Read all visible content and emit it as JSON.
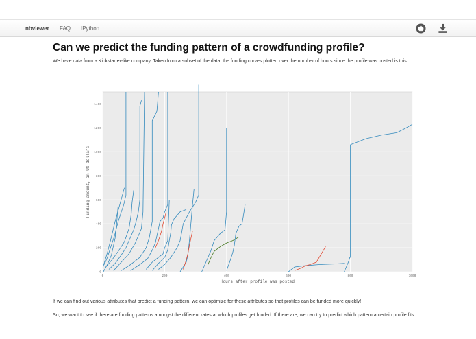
{
  "nav": {
    "brand": "nbviewer",
    "links": [
      "FAQ",
      "IPython"
    ],
    "icons": [
      "github-icon",
      "download-icon"
    ]
  },
  "page": {
    "title": "Can we predict the funding pattern of a crowdfunding profile?",
    "intro": "We have data from a Kickstarter-like company. Taken from a subset of the data, the funding curves plotted over the number of hours since the profile was posted is this:",
    "para1": "If we can find out various attributes that predict a funding pattern, we can optimize for these attributes so that profiles can be funded more quickly!",
    "para2": "So, we want to see if there are funding patterns amongst the different rates at which profiles get funded. If there are, we can try to predict which pattern a certain profile fits"
  },
  "colors": {
    "blue": "#348abd",
    "red": "#e24a33",
    "green": "#467821",
    "plot_bg": "#ebebeb",
    "grid": "#ffffff"
  },
  "chart_data": {
    "type": "line",
    "title": "",
    "xlabel": "Hours after profile was posted",
    "ylabel": "Funding amount, in US dollars",
    "xlim": [
      0,
      1000
    ],
    "ylim": [
      0,
      1500
    ],
    "xticks": [
      0,
      200,
      400,
      600,
      800,
      1000
    ],
    "yticks": [
      0,
      200,
      400,
      600,
      800,
      1000,
      1200,
      1400
    ],
    "grid": true,
    "series": [
      {
        "color": "blue",
        "x": [
          0,
          8,
          15,
          25,
          40,
          55,
          70
        ],
        "y": [
          30,
          100,
          160,
          260,
          420,
          560,
          700
        ]
      },
      {
        "color": "blue",
        "x": [
          2,
          15,
          28,
          40,
          45,
          50,
          50
        ],
        "y": [
          0,
          60,
          140,
          280,
          400,
          560,
          1500
        ]
      },
      {
        "color": "blue",
        "x": [
          5,
          15,
          25,
          38,
          50,
          60,
          68,
          75,
          75
        ],
        "y": [
          60,
          120,
          200,
          300,
          420,
          500,
          560,
          640,
          1500
        ]
      },
      {
        "color": "blue",
        "x": [
          10,
          30,
          50,
          70,
          85,
          92,
          95,
          100
        ],
        "y": [
          40,
          100,
          170,
          250,
          360,
          480,
          580,
          680
        ]
      },
      {
        "color": "blue",
        "x": [
          20,
          40,
          60,
          75,
          90,
          100,
          108,
          115,
          120,
          120,
          125
        ],
        "y": [
          20,
          70,
          140,
          200,
          290,
          350,
          420,
          500,
          600,
          1380,
          1430
        ]
      },
      {
        "color": "blue",
        "x": [
          35,
          60,
          85,
          105,
          115,
          125,
          130,
          135
        ],
        "y": [
          10,
          80,
          150,
          240,
          300,
          360,
          500,
          1500
        ]
      },
      {
        "color": "blue",
        "x": [
          60,
          90,
          120,
          140,
          150,
          155,
          160,
          160,
          175,
          180
        ],
        "y": [
          10,
          60,
          120,
          200,
          280,
          350,
          420,
          1260,
          1340,
          1500
        ]
      },
      {
        "color": "blue",
        "x": [
          90,
          120,
          145,
          160,
          170,
          175,
          180,
          185,
          195,
          200,
          210,
          210
        ],
        "y": [
          10,
          60,
          110,
          180,
          240,
          300,
          360,
          420,
          450,
          500,
          560,
          1500
        ]
      },
      {
        "color": "blue",
        "x": [
          160,
          180,
          200,
          210,
          215,
          220,
          222,
          230,
          250,
          270
        ],
        "y": [
          10,
          70,
          120,
          180,
          260,
          330,
          390,
          440,
          500,
          520
        ]
      },
      {
        "color": "blue",
        "x": [
          140,
          160,
          180,
          195,
          200,
          210,
          215
        ],
        "y": [
          20,
          80,
          120,
          150,
          200,
          260,
          600
        ]
      },
      {
        "color": "blue",
        "x": [
          180,
          200,
          220,
          240,
          250,
          255,
          260,
          280,
          300,
          310,
          310
        ],
        "y": [
          20,
          60,
          120,
          200,
          260,
          330,
          400,
          500,
          580,
          640,
          1560
        ]
      },
      {
        "color": "blue",
        "x": [
          250,
          260,
          270,
          275,
          280,
          290,
          295
        ],
        "y": [
          0,
          40,
          80,
          140,
          260,
          560,
          690
        ]
      },
      {
        "color": "blue",
        "x": [
          320,
          330,
          340,
          350,
          360,
          380,
          395,
          400,
          400
        ],
        "y": [
          0,
          60,
          120,
          180,
          260,
          320,
          350,
          500,
          1200
        ]
      },
      {
        "color": "blue",
        "x": [
          400,
          410,
          420,
          425,
          430,
          440,
          450,
          455,
          460
        ],
        "y": [
          10,
          80,
          160,
          220,
          320,
          380,
          400,
          480,
          560
        ]
      },
      {
        "color": "blue",
        "x": [
          780,
          790,
          795,
          798,
          800,
          800
        ],
        "y": [
          0,
          60,
          90,
          120,
          120,
          1060
        ]
      },
      {
        "color": "blue",
        "x": [
          800,
          820,
          850,
          900,
          950,
          980,
          1000
        ],
        "y": [
          1060,
          1080,
          1110,
          1140,
          1160,
          1200,
          1230
        ]
      },
      {
        "color": "blue",
        "x": [
          600,
          620,
          650,
          700,
          750,
          780
        ],
        "y": [
          0,
          40,
          50,
          60,
          65,
          70
        ]
      },
      {
        "color": "red",
        "x": [
          170,
          180,
          190,
          195,
          200,
          205
        ],
        "y": [
          200,
          260,
          340,
          400,
          450,
          500
        ]
      },
      {
        "color": "red",
        "x": [
          260,
          265,
          270,
          275,
          280,
          285,
          290
        ],
        "y": [
          20,
          60,
          100,
          150,
          220,
          280,
          340
        ]
      },
      {
        "color": "red",
        "x": [
          620,
          630,
          640,
          655,
          670,
          690,
          720
        ],
        "y": [
          10,
          20,
          30,
          50,
          60,
          80,
          210
        ]
      },
      {
        "color": "green",
        "x": [
          340,
          350,
          360,
          380,
          400,
          420,
          440
        ],
        "y": [
          60,
          120,
          170,
          210,
          240,
          260,
          290
        ]
      }
    ]
  }
}
